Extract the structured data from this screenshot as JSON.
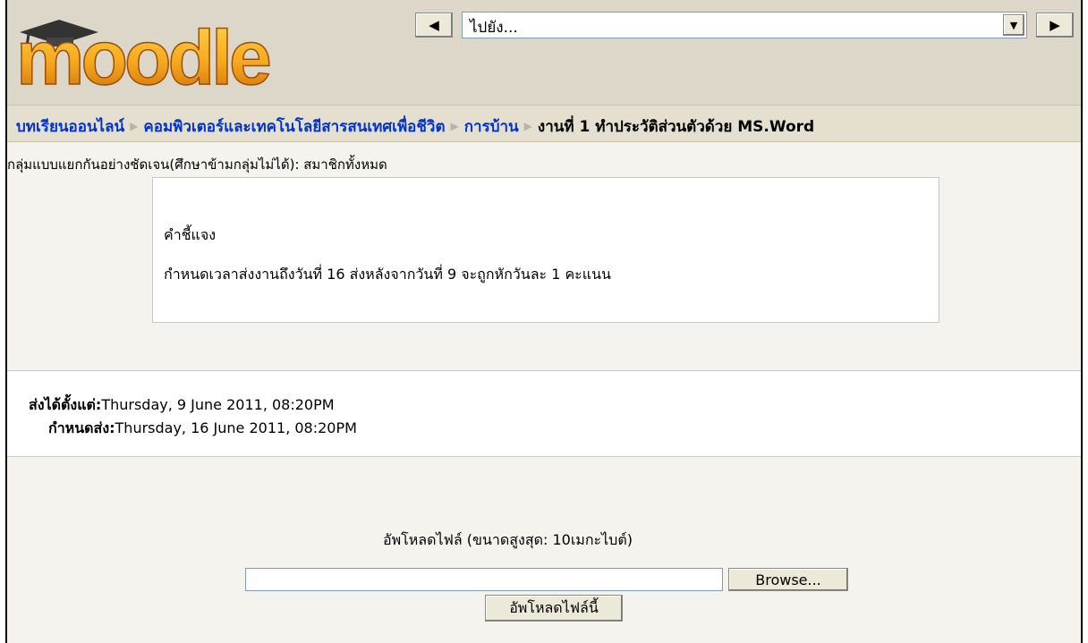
{
  "header": {
    "logo_text": "moodle",
    "jump_select": {
      "selected": "ไปยัง..."
    },
    "prev_icon": "left-triangle-icon",
    "next_icon": "right-triangle-icon"
  },
  "breadcrumb": {
    "items": [
      "บทเรียนออนไลน์",
      "คอมพิวเตอร์และเทคโนโลยีสารสนเทศเพื่อชีวิต",
      "การบ้าน"
    ],
    "current": "งานที่ 1 ทำประวัติส่วนตัวด้วย MS.Word"
  },
  "group_mode": "กลุ่มแบบแยกกันอย่างชัดเจน(ศึกษาข้ามกลุ่มไม่ได้): สมาชิกทั้งหมด",
  "description": {
    "title": "คำชี้แจง",
    "text": "กำหนดเวลาส่งงานถึงวันที่ 16 ส่งหลังจากวันที่ 9 จะถูกหักวันละ 1 คะแนน"
  },
  "dates": {
    "available_label": "ส่งได้ตั้งแต่:",
    "available_value": "Thursday, 9 June 2011, 08:20PM",
    "due_label": "กำหนดส่ง:",
    "due_value": "Thursday, 16 June 2011, 08:20PM"
  },
  "upload": {
    "title": "อัพโหลดไฟล์ (ขนาดสูงสุด: 10เมกะไบต์)",
    "browse_label": "Browse...",
    "submit_label": "อัพโหลดไฟล์นี้",
    "file_value": ""
  }
}
